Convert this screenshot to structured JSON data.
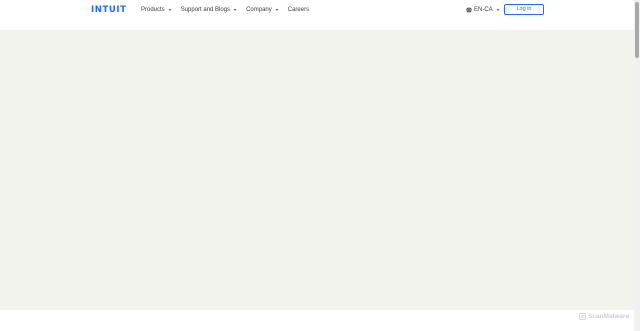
{
  "header": {
    "logo_text": "INTUIT",
    "nav": [
      {
        "label": "Products",
        "has_dropdown": true
      },
      {
        "label": "Support and Blogs",
        "has_dropdown": true
      },
      {
        "label": "Company",
        "has_dropdown": true
      },
      {
        "label": "Careers",
        "has_dropdown": false
      }
    ],
    "language": "EN-CA",
    "login_label": "Log in"
  },
  "watermark": "ScanMalware",
  "icons": {
    "globe": "globe-icon",
    "chevron": "chevron-down-icon",
    "watermark": "scanmalware-logo-icon"
  },
  "colors": {
    "brand_blue": "#236cff",
    "nav_text": "#393a3d",
    "content_bg": "#f3f3ee",
    "watermark": "#c9ced6"
  }
}
